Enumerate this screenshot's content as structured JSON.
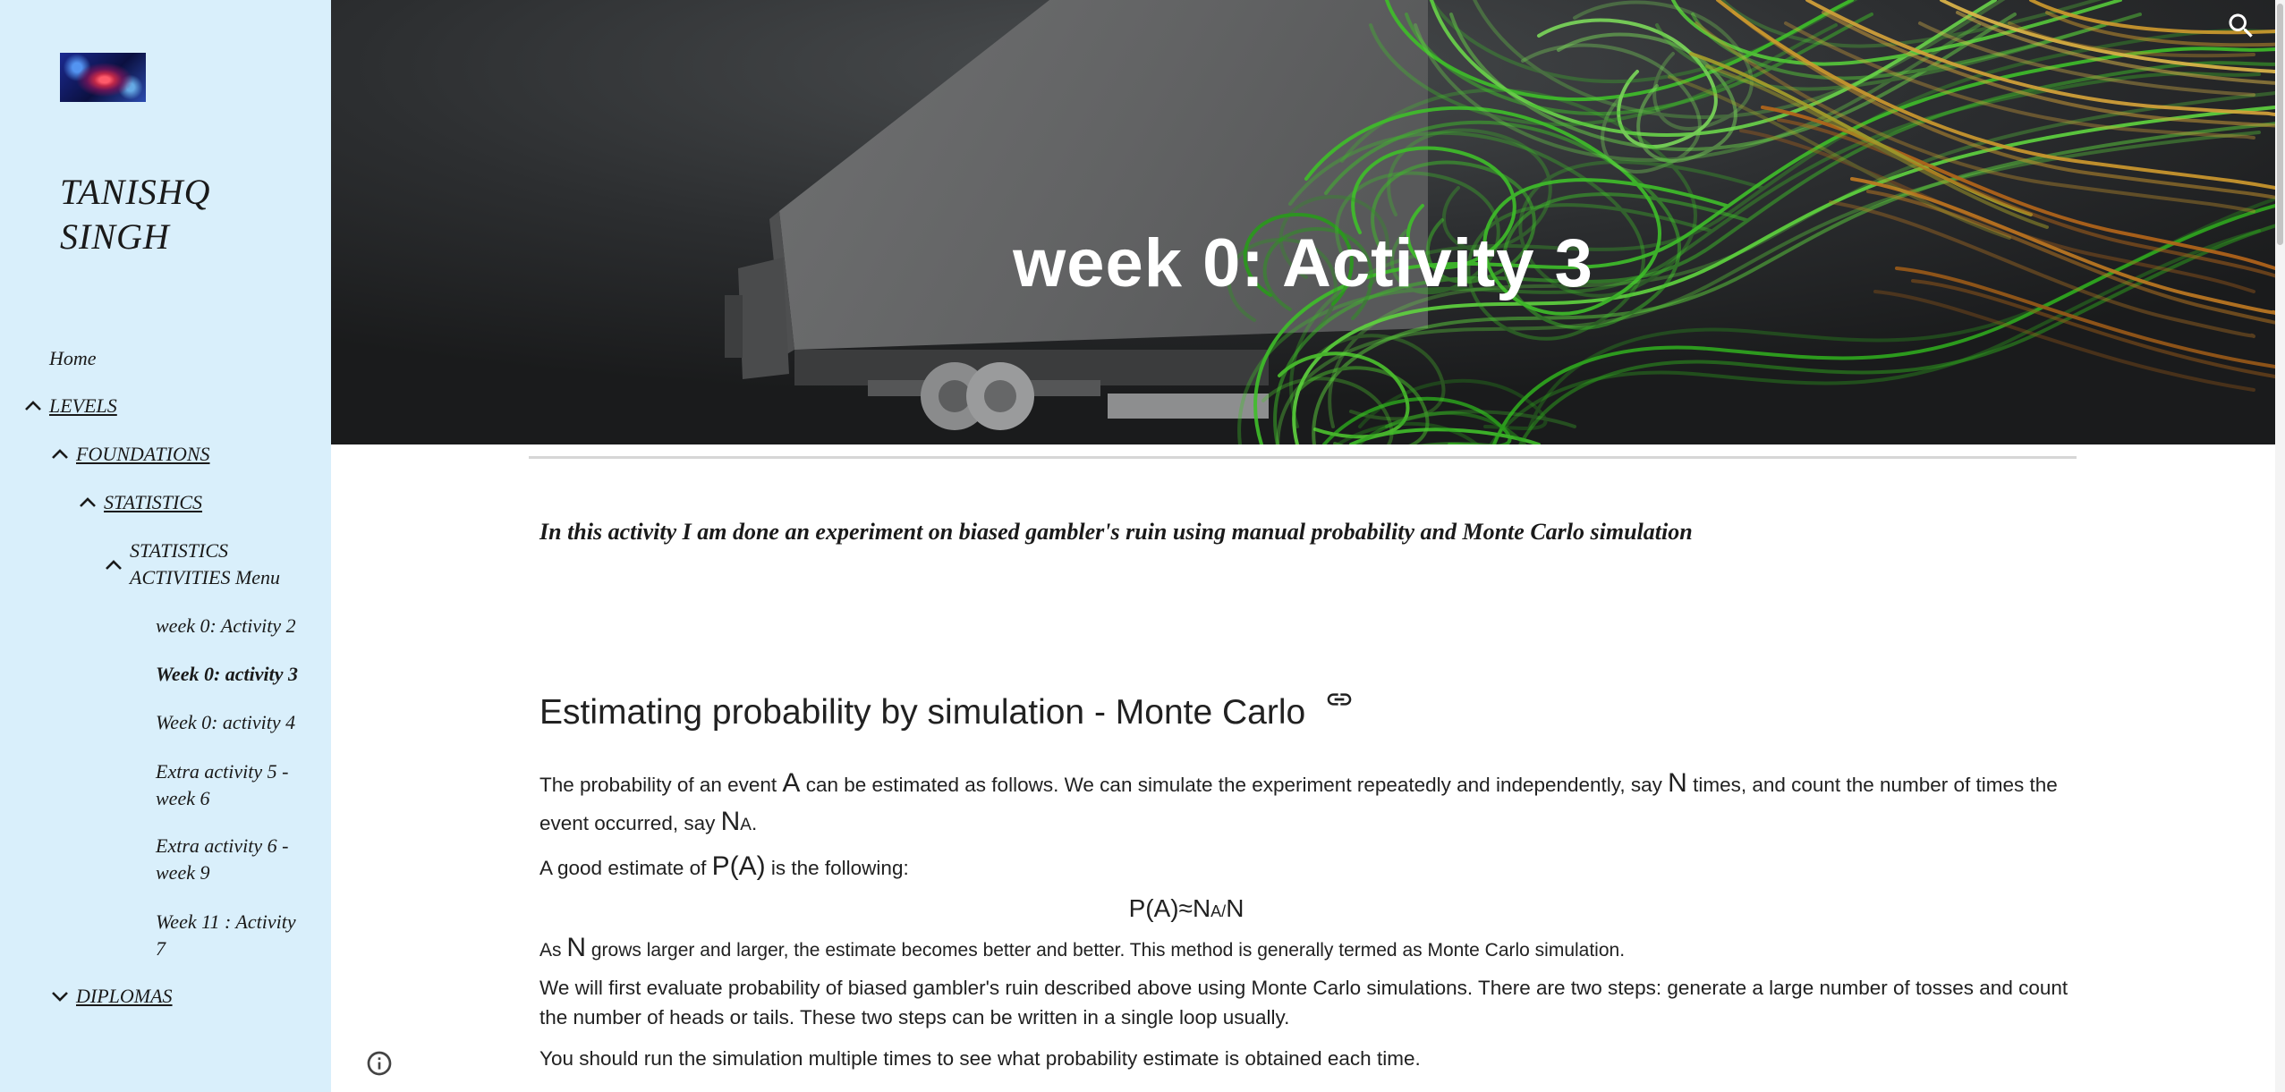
{
  "header": {
    "title": "week 0: Activity 3"
  },
  "sidebar": {
    "site_title": "TANISHQ SINGH",
    "nav": [
      {
        "label": "Home"
      },
      {
        "label": "LEVELS",
        "expanded": true
      },
      {
        "label": "FOUNDATIONS",
        "expanded": true
      },
      {
        "label": "STATISTICS",
        "expanded": true
      },
      {
        "label": "STATISTICS ACTIVITIES Menu",
        "expanded": true
      },
      {
        "label": "week 0: Activity 2"
      },
      {
        "label": "Week 0: activity 3",
        "current": true
      },
      {
        "label": "Week 0: activity 4"
      },
      {
        "label": "Extra activity 5 - week 6"
      },
      {
        "label": "Extra activity 6 - week 9"
      },
      {
        "label": "Week 11 : Activity 7"
      },
      {
        "label": "DIPLOMAS",
        "expanded": false
      }
    ]
  },
  "content": {
    "intro": "In this activity I am done an experiment on biased gambler's ruin using manual probability and Monte Carlo simulation",
    "heading": "Estimating probability by simulation - Monte Carlo",
    "p1": [
      "The probability of an event ",
      "A",
      " can be estimated as follows. We can simulate the experiment repeatedly and independently, say ",
      "N",
      " times, and count the number of times the event occurred, say ",
      "N",
      "A",
      "."
    ],
    "p2": [
      "A good estimate of ",
      "P(A)",
      " is the following:"
    ],
    "formula": [
      "P(A)≈N",
      "A/",
      "N"
    ],
    "p3": [
      "As ",
      "N",
      " grows larger and larger, the estimate becomes better and better. This method is generally termed as Monte Carlo simulation."
    ],
    "p4": "We will first evaluate probability of biased gambler's ruin described above using Monte Carlo simulations. There are two steps: generate a large number of tosses and count the number of heads or tails. These two steps can be written in a single loop usually.",
    "p5": "You should run the simulation multiple times to see what probability estimate is obtained each time."
  },
  "icons": {
    "logo": "site-logo",
    "search": "search-icon",
    "heading_link": "link-icon",
    "info": "info-icon",
    "expanded": "chevron-up-icon",
    "collapsed": "chevron-down-icon"
  },
  "colors": {
    "sidebar_bg": "#d9effb",
    "text": "#212121",
    "banner_bg": "#262829",
    "title": "#ffffff",
    "streamline_green": "#3fbf2a",
    "streamline_orange": "#cf9a2e"
  }
}
